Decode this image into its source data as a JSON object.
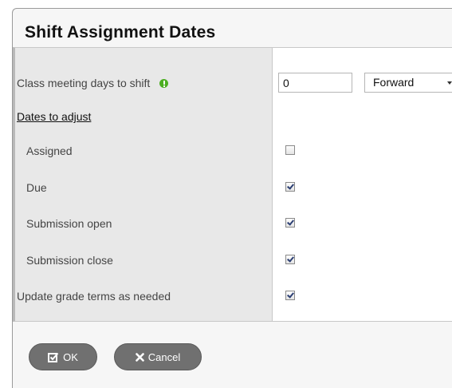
{
  "dialog": {
    "title": "Shift Assignment Dates"
  },
  "form": {
    "shift_label": "Class meeting days to shift",
    "shift_value": "0",
    "direction_selected": "Forward",
    "dates_section_label": "Dates to adjust",
    "rows": [
      {
        "label": "Assigned",
        "checked": false
      },
      {
        "label": "Due",
        "checked": true
      },
      {
        "label": "Submission open",
        "checked": true
      },
      {
        "label": "Submission close",
        "checked": true
      }
    ],
    "grade_terms_label": "Update grade terms as needed",
    "grade_terms_checked": true
  },
  "buttons": {
    "ok_label": "OK",
    "cancel_label": "Cancel"
  },
  "colors": {
    "help_icon": "#4cae22",
    "button_bg": "#707070"
  },
  "icons": {
    "help": "exclamation-circle-icon",
    "ok": "check-square-icon",
    "cancel": "x-icon"
  }
}
